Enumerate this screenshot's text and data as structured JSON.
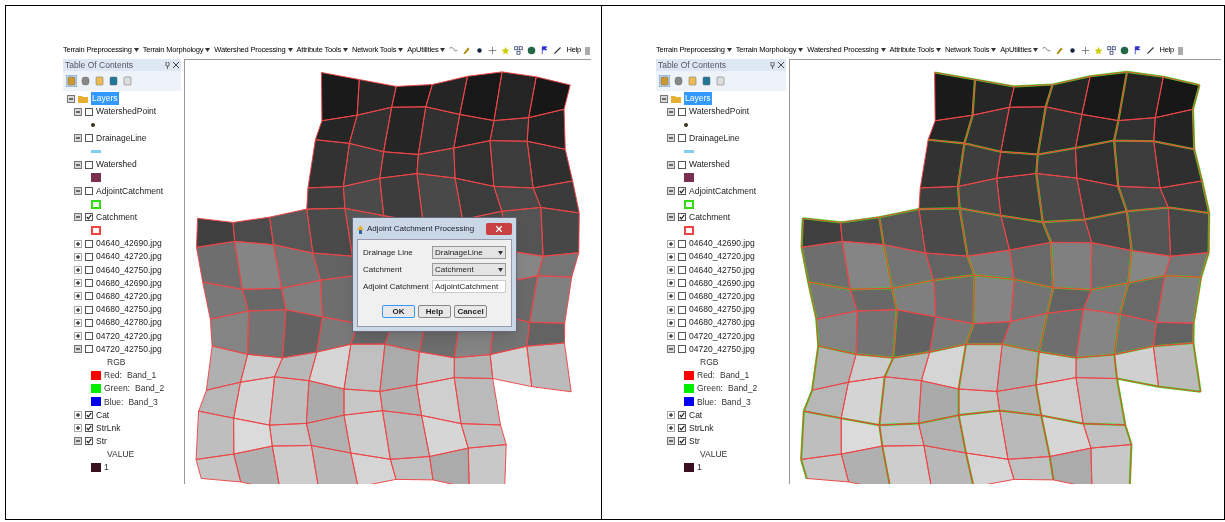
{
  "panels": [
    {
      "toolbar": {
        "menus": [
          "Terrain Preprocessing",
          "Terrain Morphology",
          "Watershed Processing",
          "Attribute Tools",
          "Network Tools",
          "ApUtilities"
        ],
        "help": "Help"
      },
      "toc": {
        "title": "Table Of Contents",
        "root": "Layers",
        "layers": [
          {
            "kind": "point",
            "name": "WatershedPoint",
            "checked": false,
            "expanded": true,
            "color": "#3a3020"
          },
          {
            "kind": "line",
            "name": "DrainageLine",
            "checked": false,
            "expanded": true,
            "color": "#7fd0f0"
          },
          {
            "kind": "fill",
            "name": "Watershed",
            "checked": false,
            "expanded": true,
            "color": "#7a3050"
          },
          {
            "kind": "outline",
            "name": "AdjointCatchment",
            "checked": false,
            "expanded": true,
            "color": "#33dd11"
          },
          {
            "kind": "outline",
            "name": "Catchment",
            "checked": true,
            "expanded": true,
            "color": "#ee4444"
          },
          {
            "kind": "raster",
            "name": "04640_42690.jpg",
            "checked": false,
            "expanded": false
          },
          {
            "kind": "raster",
            "name": "04640_42720.jpg",
            "checked": false,
            "expanded": false
          },
          {
            "kind": "raster",
            "name": "04640_42750.jpg",
            "checked": false,
            "expanded": false
          },
          {
            "kind": "raster",
            "name": "04680_42690.jpg",
            "checked": false,
            "expanded": false
          },
          {
            "kind": "raster",
            "name": "04680_42720.jpg",
            "checked": false,
            "expanded": false
          },
          {
            "kind": "raster",
            "name": "04680_42750.jpg",
            "checked": false,
            "expanded": false
          },
          {
            "kind": "raster",
            "name": "04680_42780.jpg",
            "checked": false,
            "expanded": false
          },
          {
            "kind": "raster",
            "name": "04720_42720.jpg",
            "checked": false,
            "expanded": false
          },
          {
            "kind": "raster",
            "name": "04720_42750.jpg",
            "checked": false,
            "expanded": true,
            "legend_title": "RGB",
            "legend": [
              {
                "label": "Red:",
                "value": "Band_1",
                "color": "#ff0000"
              },
              {
                "label": "Green:",
                "value": "Band_2",
                "color": "#00ee00"
              },
              {
                "label": "Blue:",
                "value": "Band_3",
                "color": "#0000ee"
              }
            ]
          },
          {
            "kind": "raster",
            "name": "Cat",
            "checked": true,
            "expanded": false
          },
          {
            "kind": "raster",
            "name": "StrLnk",
            "checked": true,
            "expanded": false
          },
          {
            "kind": "raster",
            "name": "Str",
            "checked": true,
            "expanded": true,
            "legend_title": "VALUE",
            "legend": [
              {
                "label": "1",
                "color": "#3a1020"
              }
            ]
          }
        ]
      },
      "dialog": {
        "title": "Adjoint Catchment Processing",
        "fields": [
          {
            "kind": "dropdown",
            "label": "Drainage Line",
            "value": "DrainageLine"
          },
          {
            "kind": "dropdown",
            "label": "Catchment",
            "value": "Catchment"
          },
          {
            "kind": "text",
            "label": "Adjoint Catchment",
            "value": "AdjointCatchment"
          }
        ],
        "buttons": [
          "OK",
          "Help",
          "Cancel"
        ]
      }
    },
    {
      "toolbar": {
        "menus": [
          "Terrain Preprocessing",
          "Terrain Morphology",
          "Watershed Processing",
          "Attribute Tools",
          "Network Tools",
          "ApUtilities"
        ],
        "help": "Help"
      },
      "toc": {
        "title": "Table Of Contents",
        "root": "Layers",
        "layers": [
          {
            "kind": "point",
            "name": "WatershedPoint",
            "checked": false,
            "expanded": true,
            "color": "#3a3020"
          },
          {
            "kind": "line",
            "name": "DrainageLine",
            "checked": false,
            "expanded": true,
            "color": "#7fd0f0"
          },
          {
            "kind": "fill",
            "name": "Watershed",
            "checked": false,
            "expanded": true,
            "color": "#7a3050"
          },
          {
            "kind": "outline",
            "name": "AdjointCatchment",
            "checked": true,
            "expanded": true,
            "color": "#33dd11"
          },
          {
            "kind": "outline",
            "name": "Catchment",
            "checked": true,
            "expanded": true,
            "color": "#ee4444"
          },
          {
            "kind": "raster",
            "name": "04640_42690.jpg",
            "checked": false,
            "expanded": false
          },
          {
            "kind": "raster",
            "name": "04640_42720.jpg",
            "checked": false,
            "expanded": false
          },
          {
            "kind": "raster",
            "name": "04640_42750.jpg",
            "checked": false,
            "expanded": false
          },
          {
            "kind": "raster",
            "name": "04680_42690.jpg",
            "checked": false,
            "expanded": false
          },
          {
            "kind": "raster",
            "name": "04680_42720.jpg",
            "checked": false,
            "expanded": false
          },
          {
            "kind": "raster",
            "name": "04680_42750.jpg",
            "checked": false,
            "expanded": false
          },
          {
            "kind": "raster",
            "name": "04680_42780.jpg",
            "checked": false,
            "expanded": false
          },
          {
            "kind": "raster",
            "name": "04720_42720.jpg",
            "checked": false,
            "expanded": false
          },
          {
            "kind": "raster",
            "name": "04720_42750.jpg",
            "checked": false,
            "expanded": true,
            "legend_title": "RGB",
            "legend": [
              {
                "label": "Red:",
                "value": "Band_1",
                "color": "#ff0000"
              },
              {
                "label": "Green:",
                "value": "Band_2",
                "color": "#00ee00"
              },
              {
                "label": "Blue:",
                "value": "Band_3",
                "color": "#0000ee"
              }
            ]
          },
          {
            "kind": "raster",
            "name": "Cat",
            "checked": true,
            "expanded": false
          },
          {
            "kind": "raster",
            "name": "StrLnk",
            "checked": true,
            "expanded": false
          },
          {
            "kind": "raster",
            "name": "Str",
            "checked": true,
            "expanded": true,
            "legend_title": "VALUE",
            "legend": [
              {
                "label": "1",
                "color": "#3a1020"
              }
            ]
          }
        ]
      }
    }
  ]
}
